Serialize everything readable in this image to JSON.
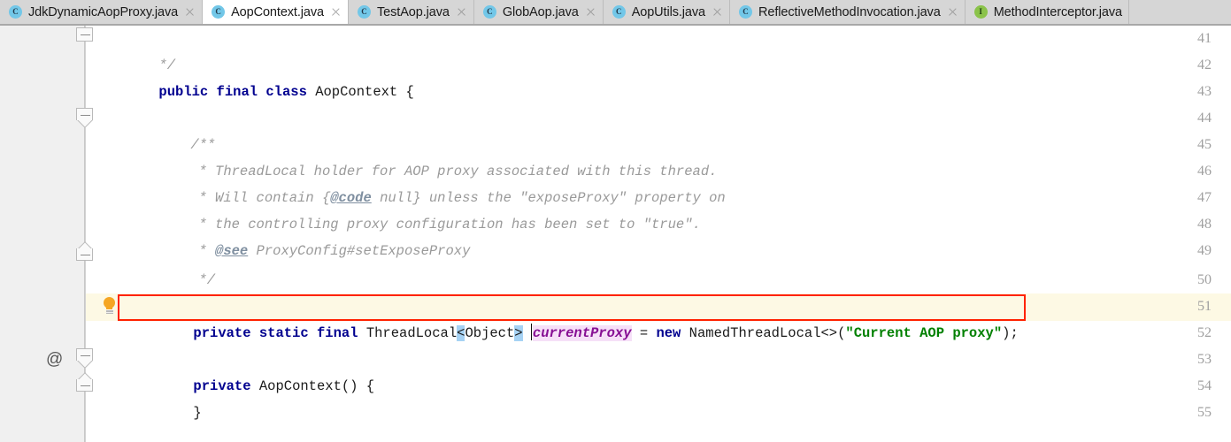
{
  "window": {
    "title": "AopContext.java - IDE Editor"
  },
  "tabs": {
    "items": [
      {
        "label": "JdkDynamicAopProxy.java",
        "icon": "java-class-icon",
        "icon_glyph": "C",
        "kind": "class",
        "active": false,
        "closable": true
      },
      {
        "label": "AopContext.java",
        "icon": "java-class-icon",
        "icon_glyph": "C",
        "kind": "class",
        "active": true,
        "closable": true
      },
      {
        "label": "TestAop.java",
        "icon": "java-class-icon",
        "icon_glyph": "C",
        "kind": "class",
        "active": false,
        "closable": true
      },
      {
        "label": "GlobAop.java",
        "icon": "java-class-icon",
        "icon_glyph": "C",
        "kind": "class",
        "active": false,
        "closable": true
      },
      {
        "label": "AopUtils.java",
        "icon": "java-class-icon",
        "icon_glyph": "C",
        "kind": "class",
        "active": false,
        "closable": true
      },
      {
        "label": "ReflectiveMethodInvocation.java",
        "icon": "java-class-icon",
        "icon_glyph": "C",
        "kind": "class",
        "active": false,
        "closable": true
      },
      {
        "label": "MethodInterceptor.java",
        "icon": "java-interface-icon",
        "icon_glyph": "I",
        "kind": "interface",
        "active": false,
        "closable": true
      }
    ]
  },
  "editor": {
    "line_numbers": [
      "41",
      "42",
      "43",
      "44",
      "45",
      "46",
      "47",
      "48",
      "49",
      "50",
      "51",
      "52",
      "53",
      "54",
      "55"
    ],
    "caret_line": "50",
    "annotation_marker": "@",
    "annotation_marker_line": "53",
    "quick_fix_icon": "lightbulb-icon",
    "lines": {
      "l41": "*/",
      "l42_kw1": "public",
      "l42_kw2": "final",
      "l42_kw3": "class",
      "l42_name": "AopContext",
      "l42_brace": "{",
      "l44": "/**",
      "l45": "* ThreadLocal holder for AOP proxy associated with this thread.",
      "l46_a": "* Will contain {",
      "l46_tag": "@code",
      "l46_b": " null} unless the \"exposeProxy\" property on",
      "l47": "* the controlling proxy configuration has been set to \"true\".",
      "l48_a": "* ",
      "l48_tag": "@see",
      "l48_b": " ProxyConfig#setExposeProxy",
      "l49": "*/",
      "l50_kw1": "private",
      "l50_kw2": "static",
      "l50_kw3": "final",
      "l50_type": "ThreadLocal",
      "l50_lt": "<",
      "l50_generic": "Object",
      "l50_gt": ">",
      "l50_field": "currentProxy",
      "l50_eq": "=",
      "l50_new": "new",
      "l50_ctor": "NamedThreadLocal<>(",
      "l50_str": "\"Current AOP proxy\"",
      "l50_end": ");",
      "l53_kw": "private",
      "l53_rest": "AopContext() {",
      "l54": "}"
    }
  },
  "colors": {
    "keyword": "#00008f",
    "comment": "#9a9a9a",
    "string": "#008000",
    "field": "#871094",
    "caret_row": "#fdf9e4",
    "annotation_box": "#ff2200",
    "bracket_selection": "#a6d2f4",
    "identifier_highlight": "#f6e0f8",
    "tabbar": "#d6d6d6",
    "gutter": "#f0f0f0"
  }
}
